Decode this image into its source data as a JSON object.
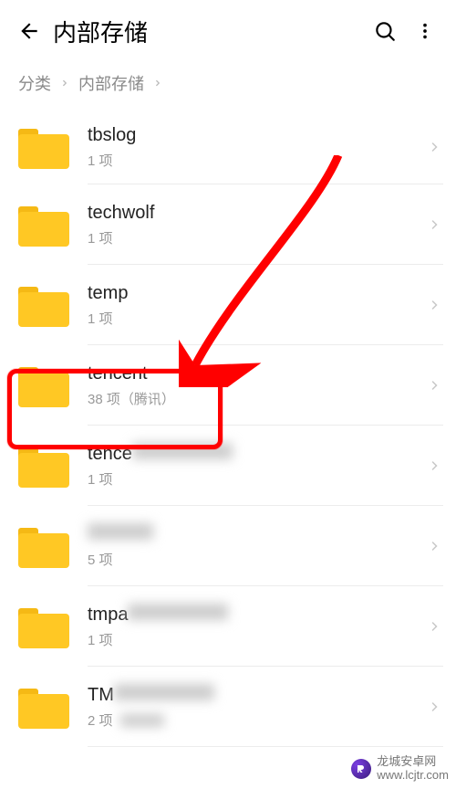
{
  "header": {
    "title": "内部存储"
  },
  "breadcrumb": {
    "root": "分类",
    "current": "内部存储"
  },
  "folders": [
    {
      "name": "tbslog",
      "meta": "1 项",
      "obscured_name": false,
      "obscured_meta": false
    },
    {
      "name": "techwolf",
      "meta": "1 项",
      "obscured_name": false,
      "obscured_meta": false
    },
    {
      "name": "temp",
      "meta": "1 项",
      "obscured_name": false,
      "obscured_meta": false
    },
    {
      "name": "tencent",
      "meta": "38 项（腾讯）",
      "obscured_name": false,
      "obscured_meta": false
    },
    {
      "name": "tence",
      "meta": "1 项",
      "obscured_name": true,
      "obscured_meta": false
    },
    {
      "name": "",
      "meta": "5 项",
      "obscured_name": true,
      "obscured_meta": false
    },
    {
      "name": "tmpa",
      "meta": "1 项",
      "obscured_name": true,
      "obscured_meta": false
    },
    {
      "name": "TM",
      "meta": "2 项",
      "obscured_name": true,
      "obscured_meta": true
    }
  ],
  "highlight_index": 3,
  "watermark": {
    "line1": "龙城安卓网",
    "line2": "www.lcjtr.com"
  }
}
